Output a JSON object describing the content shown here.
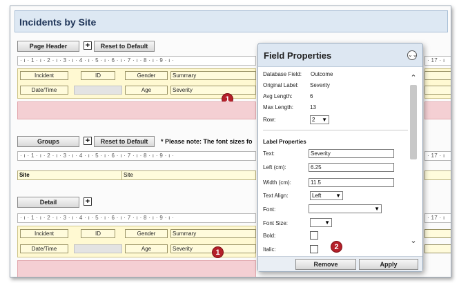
{
  "window": {
    "title": "Incidents by Site"
  },
  "page_header": {
    "button_label": "Page Header",
    "expand_glyph": "+",
    "reset_label": "Reset to Default"
  },
  "groups": {
    "button_label": "Groups",
    "expand_glyph": "+",
    "reset_label": "Reset to Default",
    "note": "* Please note: The font sizes fo"
  },
  "detail": {
    "button_label": "Detail",
    "expand_glyph": "+"
  },
  "ruler": {
    "text": "· ı · 1 · ı · 2 · ı · 3 · ı · 4 · ı · 5 · ı · 6 · ı · 7 · ı · 8 · ı · 9 · ı ·",
    "tail": "· 17 · ı"
  },
  "header_fields": {
    "row1": [
      "Incident",
      "ID",
      "Gender",
      "Summary"
    ],
    "row2": [
      "Date/Time",
      "",
      "Age",
      "Severity"
    ]
  },
  "group_fields": {
    "label": "Site",
    "value": "Site"
  },
  "detail_fields": {
    "row1": [
      "Incident",
      "ID",
      "Gender",
      "Summary"
    ],
    "row2": [
      "Date/Time",
      "",
      "Age",
      "Severity"
    ]
  },
  "markers": {
    "one": "1",
    "two": "2"
  },
  "panel": {
    "title": "Field Properties",
    "collapse_icon": "⌄⌄",
    "database_field": {
      "label": "Database Field:",
      "value": "Outcome"
    },
    "original_label": {
      "label": "Original Label:",
      "value": "Severity"
    },
    "avg_length": {
      "label": "Avg Length:",
      "value": "6"
    },
    "max_length": {
      "label": "Max Length:",
      "value": "13"
    },
    "row": {
      "label": "Row:",
      "value": "2"
    },
    "label_properties": "Label Properties",
    "text": {
      "label": "Text:",
      "value": "Severity"
    },
    "left": {
      "label": "Left (cm):",
      "value": "6.25"
    },
    "width": {
      "label": "Width (cm):",
      "value": "11.5"
    },
    "text_align": {
      "label": "Text Align:",
      "value": "Left"
    },
    "font": {
      "label": "Font:",
      "value": ""
    },
    "font_size": {
      "label": "Font Size:",
      "value": ""
    },
    "bold": {
      "label": "Bold:"
    },
    "italic": {
      "label": "Italic:"
    },
    "remove_label": "Remove",
    "apply_label": "Apply",
    "scroll_up": "⌃",
    "scroll_down": "⌄"
  },
  "colors": {
    "band": "#fff9d2",
    "pink": "#f4cfd3",
    "marker": "#b4202a",
    "title_bg": "#dde8f3"
  }
}
